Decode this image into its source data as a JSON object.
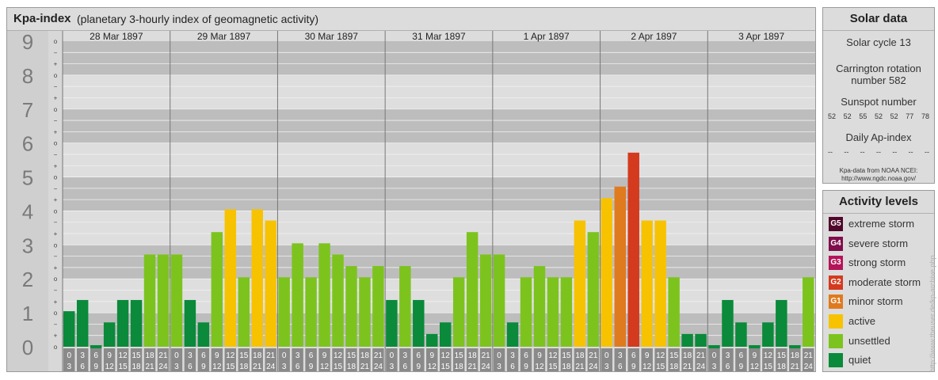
{
  "header": {
    "title": "Kpa-index",
    "subtitle": "(planetary 3-hourly index of geomagnetic activity)"
  },
  "chart_data": {
    "type": "bar",
    "y_axis": {
      "min": 0,
      "max": 9,
      "ticks": [
        "0",
        "1",
        "2",
        "3",
        "4",
        "5",
        "6",
        "7",
        "8",
        "9"
      ],
      "sub_ticks": [
        "o",
        "+",
        "−"
      ]
    },
    "days": [
      "28 Mar 1897",
      "29 Mar 1897",
      "30 Mar 1897",
      "31 Mar 1897",
      "1 Apr 1897",
      "2 Apr 1897",
      "3 Apr 1897"
    ],
    "interval_labels": [
      [
        "0",
        "3"
      ],
      [
        "3",
        "6"
      ],
      [
        "6",
        "9"
      ],
      [
        "9",
        "12"
      ],
      [
        "12",
        "15"
      ],
      [
        "15",
        "18"
      ],
      [
        "18",
        "21"
      ],
      [
        "21",
        "24"
      ]
    ],
    "values": [
      1.0,
      1.33,
      0.0,
      0.67,
      1.33,
      1.33,
      2.67,
      2.67,
      2.67,
      1.33,
      0.67,
      3.33,
      4.0,
      2.0,
      4.0,
      3.67,
      2.0,
      3.0,
      2.0,
      3.0,
      2.67,
      2.33,
      2.0,
      2.33,
      1.33,
      2.33,
      1.33,
      0.33,
      0.67,
      2.0,
      3.33,
      2.67,
      2.67,
      0.67,
      2.0,
      2.33,
      2.0,
      2.0,
      3.67,
      3.33,
      4.33,
      4.67,
      5.67,
      3.67,
      3.67,
      2.0,
      0.33,
      0.33,
      0.0,
      1.33,
      0.67,
      0.0,
      0.67,
      1.33,
      0.0,
      2.0
    ],
    "level_colors": {
      "quiet": "#0a8a3a",
      "unsettled": "#7dc31e",
      "active": "#f7c200",
      "G1": "#e07a1e",
      "G2": "#d43a1e",
      "G3": "#b4145a",
      "G4": "#800e4c",
      "G5": "#50082a"
    }
  },
  "solar": {
    "title": "Solar data",
    "cycle": "Solar cycle 13",
    "carrington_line1": "Carrington rotation",
    "carrington_line2": "number 582",
    "sunspot_title": "Sunspot number",
    "sunspot_values": [
      "52",
      "52",
      "55",
      "52",
      "52",
      "77",
      "78"
    ],
    "ap_title": "Daily Ap-index",
    "ap_values": [
      "--",
      "--",
      "--",
      "--",
      "--",
      "--",
      "--"
    ],
    "source_line1": "Kpa-data from NOAA NCEI:",
    "source_line2": "http://www.ngdc.noaa.gov/"
  },
  "activity": {
    "title": "Activity levels",
    "items": [
      {
        "code": "G5",
        "label": "extreme storm",
        "color": "#50082a"
      },
      {
        "code": "G4",
        "label": "severe storm",
        "color": "#800e4c"
      },
      {
        "code": "G3",
        "label": "strong storm",
        "color": "#b4145a"
      },
      {
        "code": "G2",
        "label": "moderate storm",
        "color": "#d43a1e"
      },
      {
        "code": "G1",
        "label": "minor storm",
        "color": "#e07a1e"
      },
      {
        "code": "",
        "label": "active",
        "color": "#f7c200"
      },
      {
        "code": "",
        "label": "unsettled",
        "color": "#7dc31e"
      },
      {
        "code": "",
        "label": "quiet",
        "color": "#0a8a3a"
      }
    ]
  },
  "credit": "http://www.theuser.de/kp-archive.php"
}
